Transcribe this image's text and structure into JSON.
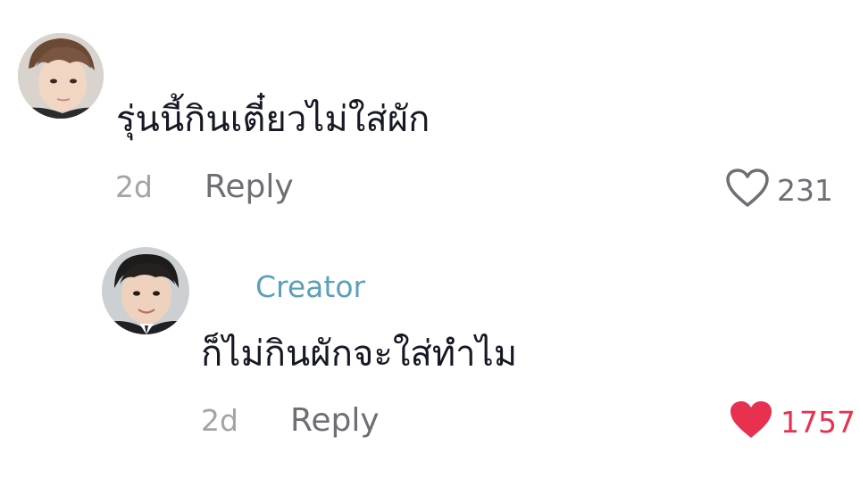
{
  "comments": [
    {
      "text": "รุ่นนี้กินเตี๋ยวไม่ใส่ผัก",
      "time": "2d",
      "reply_label": "Reply",
      "likes": "231",
      "liked": false
    },
    {
      "badge": "Creator",
      "text": "ก็ไม่กินผักจะใส่ทำไม",
      "time": "2d",
      "reply_label": "Reply",
      "likes": "1757",
      "liked": true
    }
  ],
  "colors": {
    "creator_badge": "#5b9fbd",
    "liked_heart": "#e8314f",
    "unliked_heart": "#6e6f74",
    "meta_text": "#a3a4a7"
  },
  "icons": {
    "like_outline": "heart-outline-icon",
    "like_filled": "heart-filled-icon"
  }
}
